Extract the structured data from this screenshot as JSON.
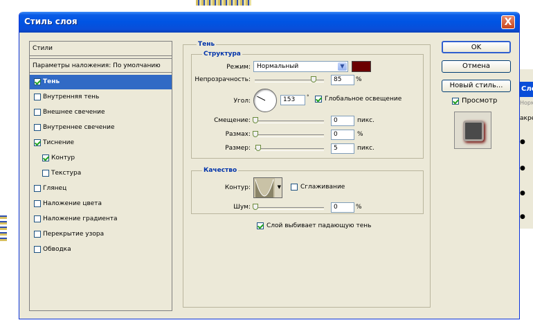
{
  "dialog": {
    "title": "Стиль слоя",
    "close_glyph": "X"
  },
  "styles_panel": {
    "header": "Стили",
    "blend_options": "Параметры наложения: По умолчанию",
    "items": [
      {
        "label": "Тень",
        "checked": true,
        "selected": true,
        "indent": false
      },
      {
        "label": "Внутренняя тень",
        "checked": false,
        "selected": false,
        "indent": false
      },
      {
        "label": "Внешнее свечение",
        "checked": false,
        "selected": false,
        "indent": false
      },
      {
        "label": "Внутреннее свечение",
        "checked": false,
        "selected": false,
        "indent": false
      },
      {
        "label": "Тиснение",
        "checked": true,
        "selected": false,
        "indent": false
      },
      {
        "label": "Контур",
        "checked": true,
        "selected": false,
        "indent": true
      },
      {
        "label": "Текстура",
        "checked": false,
        "selected": false,
        "indent": true
      },
      {
        "label": "Глянец",
        "checked": false,
        "selected": false,
        "indent": false
      },
      {
        "label": "Наложение цвета",
        "checked": false,
        "selected": false,
        "indent": false
      },
      {
        "label": "Наложение градиента",
        "checked": false,
        "selected": false,
        "indent": false
      },
      {
        "label": "Перекрытие узора",
        "checked": false,
        "selected": false,
        "indent": false
      },
      {
        "label": "Обводка",
        "checked": false,
        "selected": false,
        "indent": false
      }
    ]
  },
  "shadow": {
    "group_title": "Тень",
    "structure_title": "Структура",
    "mode_label": "Режим:",
    "mode_value": "Нормальный",
    "mode_color": "#6b0000",
    "opacity_label": "Непрозрачность:",
    "opacity_value": "85",
    "opacity_unit": "%",
    "opacity_level": 0.85,
    "angle_label": "Угол:",
    "angle_value": "153",
    "angle_unit": "°",
    "global_light_label": "Глобальное освещение",
    "global_light_checked": true,
    "offset_label": "Смещение:",
    "offset_value": "0",
    "offset_unit": "пикс.",
    "spread_label": "Размах:",
    "spread_value": "0",
    "spread_unit": "%",
    "size_label": "Размер:",
    "size_value": "5",
    "size_unit": "пикс."
  },
  "quality": {
    "title": "Качество",
    "contour_label": "Контур:",
    "antialias_label": "Сглаживание",
    "antialias_checked": false,
    "noise_label": "Шум:",
    "noise_value": "0",
    "noise_unit": "%",
    "knockout_label": "Слой выбивает падающую тень",
    "knockout_checked": true
  },
  "buttons": {
    "ok": "OK",
    "cancel": "Отмена",
    "new_style": "Новый стиль...",
    "preview_label": "Просмотр",
    "preview_checked": true
  },
  "background_app": {
    "panel_title": "Сло",
    "mode_fragment": "Норм",
    "lock_fragment": "акре"
  }
}
